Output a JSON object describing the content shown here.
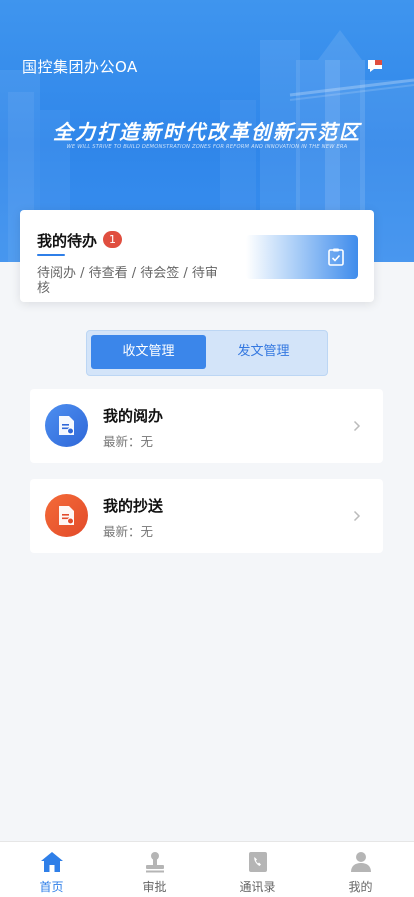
{
  "header": {
    "app_title": "国控集团办公OA",
    "slogan": "全力打造新时代改革创新示范区",
    "slogan_en": "WE WILL STRIVE TO BUILD DEMONSTRATION ZONES FOR REFORM AND INNOVATION IN THE NEW ERA",
    "message_icon": "message-icon"
  },
  "todo": {
    "title": "我的待办",
    "count": "1",
    "subtitle": "待阅办 / 待查看 / 待会签 / 待审核",
    "action_icon": "clipboard-check-icon"
  },
  "tabs": [
    {
      "label": "收文管理",
      "active": true
    },
    {
      "label": "发文管理",
      "active": false
    }
  ],
  "items": [
    {
      "title": "我的阅办",
      "latest": "最新：无",
      "icon": "document-read-icon",
      "color": "#2f67d8"
    },
    {
      "title": "我的抄送",
      "latest": "最新：无",
      "icon": "document-cc-icon",
      "color": "#e24a2a"
    }
  ],
  "tabbar": [
    {
      "label": "首页",
      "icon": "home-icon",
      "active": true
    },
    {
      "label": "审批",
      "icon": "stamp-icon",
      "active": false
    },
    {
      "label": "通讯录",
      "icon": "phone-book-icon",
      "active": false
    },
    {
      "label": "我的",
      "icon": "user-icon",
      "active": false
    }
  ],
  "colors": {
    "accent": "#2f7fe8",
    "badge": "#e04e3f"
  }
}
